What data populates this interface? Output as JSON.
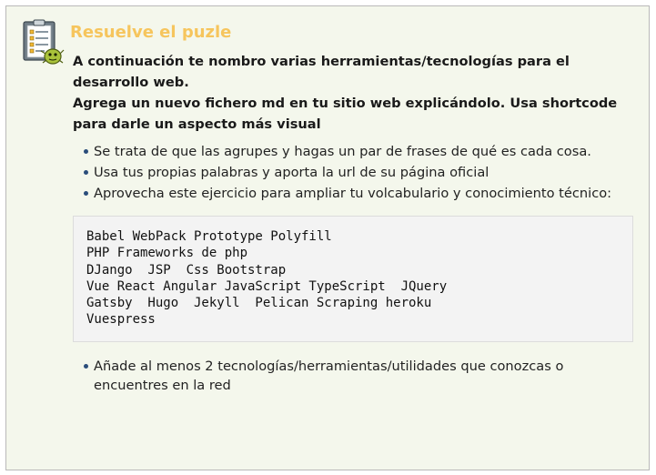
{
  "activity": {
    "icon": "checklist-clipboard-icon",
    "title": "Resuelve el puzle",
    "intro": [
      "A continuación te nombro varias herramientas/tecnologías para el desarrollo web.",
      "Agrega un nuevo fichero md en tu sitio web explicándolo. Usa shortcode para darle un aspecto más visual"
    ],
    "tips": [
      "Se trata de que las agrupes y hagas un par de frases de qué es cada cosa.",
      "Usa tus propias palabras y aporta la url de su página oficial",
      "Aprovecha este ejercicio para ampliar tu volcabulario y conocimiento técnico:"
    ],
    "code_lines": [
      "Babel WebPack Prototype Polyfill",
      "PHP Frameworks de php",
      "DJango  JSP  Css Bootstrap",
      "Vue React Angular JavaScript TypeScript  JQuery",
      "Gatsby  Hugo  Jekyll  Pelican Scraping heroku",
      "Vuespress"
    ],
    "tips_after": [
      "Añade al menos 2 tecnologías/herramientas/utilidades que conozcas o encuentres en la red"
    ]
  },
  "colors": {
    "card_background": "#f4f7ec",
    "title": "#f6c55d",
    "bullet": "#2a4d7a",
    "code_background": "#f3f3f3"
  }
}
